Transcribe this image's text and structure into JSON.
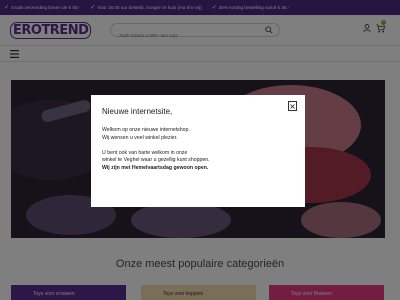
{
  "topbar": {
    "usps": [
      "Gratis verzending boven de € 50,-",
      "Voor 16.00 uur besteld, morgen in huis (ma t/m vrij)",
      "30% korting bestelling vanaf € 35,-"
    ]
  },
  "header": {
    "logo_text": "EROTREND",
    "search_placeholder": "Zoek tussen 4.000+ sex toys",
    "cart_count": "0"
  },
  "main": {
    "section_title": "Onze meest populaire categorieën",
    "categories": [
      "Toys voor vrouwen",
      "Toys voor koppels",
      "Toys voor Mannen"
    ]
  },
  "modal": {
    "title": "Nieuwe internetsite,",
    "line1": "Welkom op onze nieuwe internetshop.",
    "line2": "Wij wensen u veel winkel plezier.",
    "line3": "U bent ook van harte welkom in onze",
    "line4": "winkel te Veghel waar u gezellig kunt shoppen.",
    "line5": "Wij zijn met Hemelvaartsdag gewoon open."
  },
  "colors": {
    "brand_purple": "#5b2c91",
    "topbar": "#4a2a87",
    "cart_badge": "#6bb32a"
  }
}
